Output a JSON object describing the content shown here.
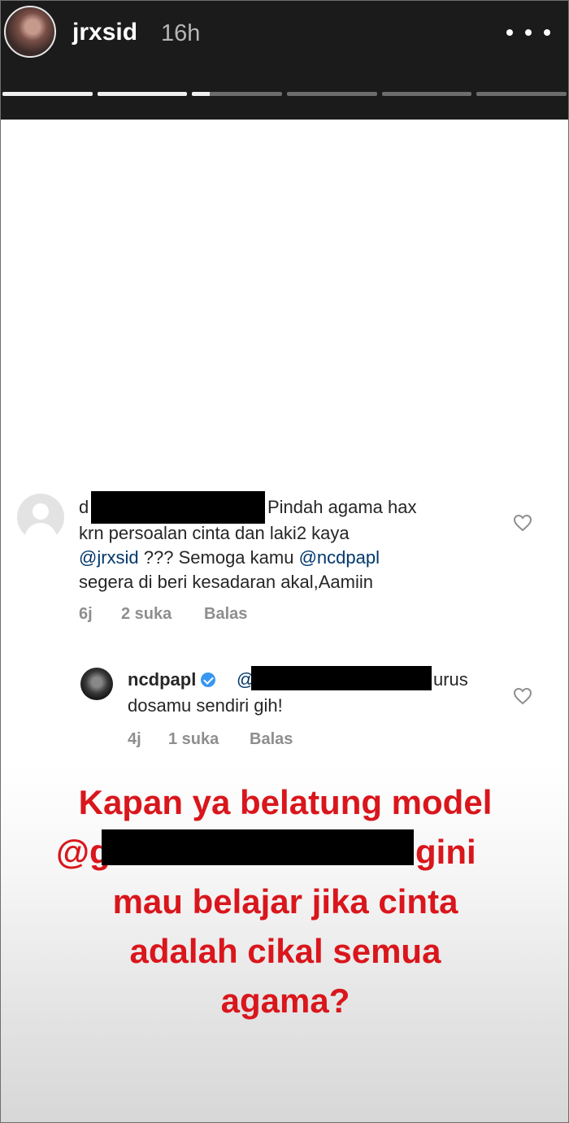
{
  "story": {
    "username": "jrxsid",
    "time": "16h",
    "progress": [
      1,
      1,
      0.2,
      0,
      0,
      0
    ]
  },
  "comment1": {
    "username_initial": "d",
    "line1": "Pindah agama hax",
    "line2": "krn persoalan cinta dan laki2 kaya",
    "mention1": "@jrxsid",
    "text_after_mention1": " ??? Semoga kamu ",
    "mention2": "@ncdpapl",
    "line4": "segera di beri kesadaran akal,Aamiin",
    "time": "6j",
    "likes": "2 suka",
    "reply": "Balas"
  },
  "comment2": {
    "username": "ncdpapl",
    "mention_prefix": "@",
    "text_after": "urus",
    "line2": "dosamu sendiri gih!",
    "time": "4j",
    "likes": "1 suka",
    "reply": "Balas"
  },
  "caption": {
    "line1": "Kapan ya belatung model",
    "line2_prefix": "@g",
    "line2_suffix": "gini",
    "line3": "mau belajar jika cinta",
    "line4": "adalah cikal semua",
    "line5": "agama?"
  },
  "colors": {
    "caption_red": "#d9161c",
    "mention_blue": "#00376b",
    "verified_blue": "#3897f0"
  }
}
